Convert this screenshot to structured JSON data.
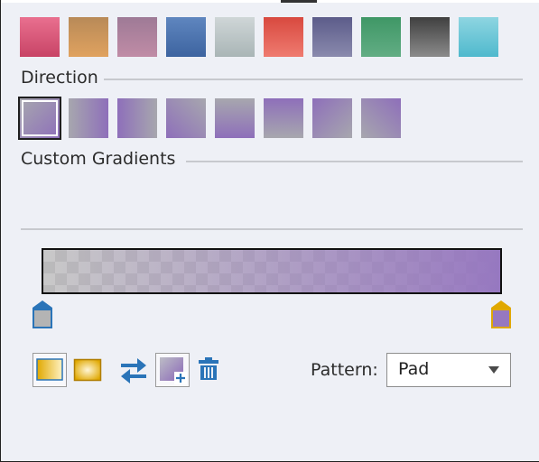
{
  "preset_gradients": [
    {
      "name": "pink",
      "from": "#e9708f",
      "to": "#c84466"
    },
    {
      "name": "orange",
      "from": "#b88a58",
      "to": "#e0a25f"
    },
    {
      "name": "mauve",
      "from": "#9e7a96",
      "to": "#c08ca6"
    },
    {
      "name": "blue",
      "from": "#5f86bf",
      "to": "#3d64a0"
    },
    {
      "name": "silver",
      "from": "#cfd6d7",
      "to": "#a9b5b6"
    },
    {
      "name": "red",
      "from": "#d8493f",
      "to": "#ef7b70"
    },
    {
      "name": "slate",
      "from": "#5c5c8a",
      "to": "#8a8aad"
    },
    {
      "name": "green",
      "from": "#3f9766",
      "to": "#62ad84"
    },
    {
      "name": "black",
      "from": "#404040",
      "to": "#8b8b8b"
    },
    {
      "name": "cyan",
      "from": "#8ed5e1",
      "to": "#4fb9cd"
    }
  ],
  "direction": {
    "label": "Direction",
    "colors": {
      "from": "#a7a7ae",
      "to": "#8e6fba"
    },
    "options": [
      "to bottom right",
      "to right",
      "to left",
      "to bottom left",
      "to bottom",
      "to top",
      "to top left",
      "to top right"
    ],
    "selected_index": 0
  },
  "custom_gradients": {
    "label": "Custom Gradients"
  },
  "gradient_editor": {
    "stops": [
      {
        "position": 0,
        "color": "#b4b4b4",
        "outline": "#2a74b8"
      },
      {
        "position": 1,
        "color": "#9678c0",
        "outline": "#e0a800"
      }
    ]
  },
  "toolbar": {
    "buttons": [
      "linear-gradient-icon",
      "radial-gradient-icon",
      "swap-colors-icon",
      "add-gradient-icon",
      "delete-icon"
    ]
  },
  "pattern": {
    "label": "Pattern:",
    "selected": "Pad"
  },
  "colors": {
    "accent_blue": "#2a74b8",
    "accent_gold": "#e0a800",
    "panel_bg": "#eef0f6"
  }
}
